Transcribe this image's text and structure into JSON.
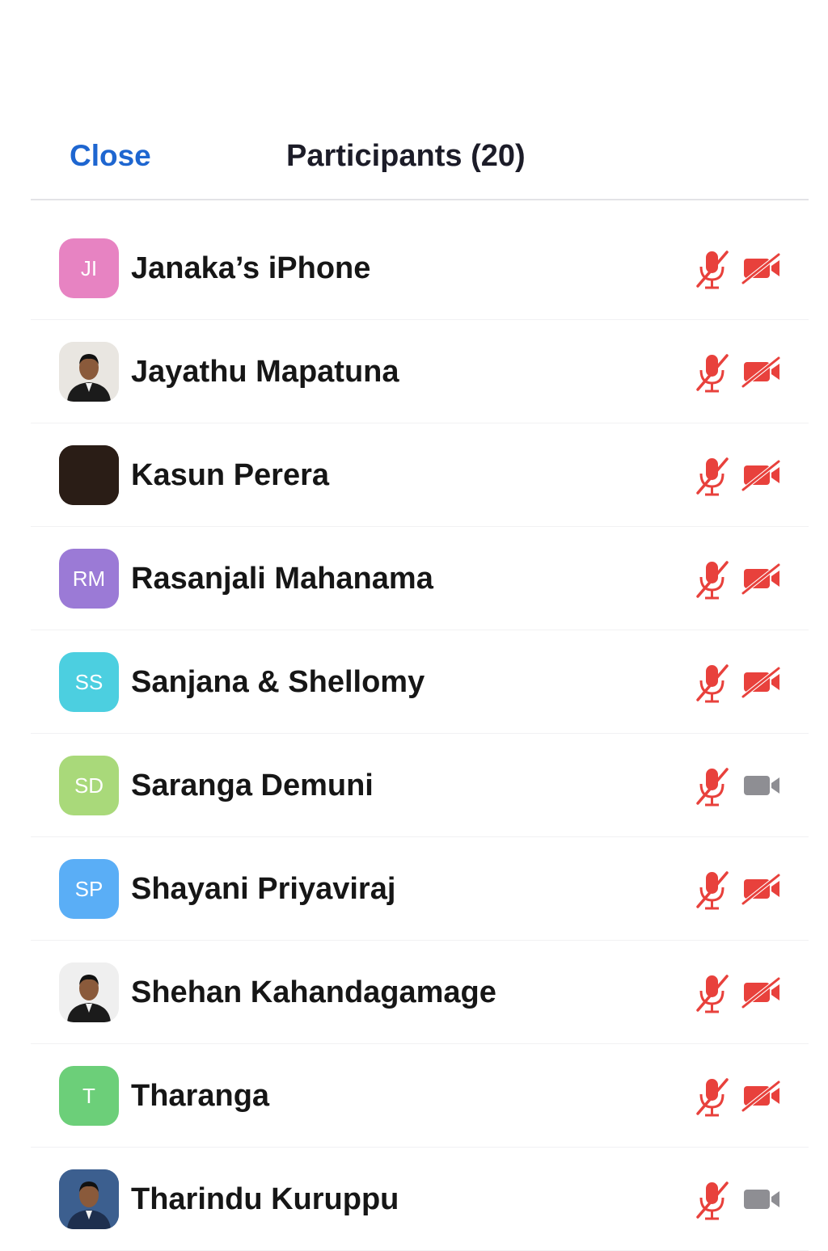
{
  "header": {
    "close_label": "Close",
    "title": "Participants (20)"
  },
  "colors": {
    "accent": "#1e66d0",
    "muted_red": "#e8413c",
    "video_on_gray": "#8e8e93"
  },
  "participants": [
    {
      "name": "Janaka’s iPhone",
      "initials": "JI",
      "avatar_type": "initials",
      "avatar_color": "#e783c2",
      "mic": "muted",
      "video": "off"
    },
    {
      "name": "Jayathu Mapatuna",
      "initials": "",
      "avatar_type": "photo",
      "avatar_color": "#e9e6e1",
      "mic": "muted",
      "video": "off"
    },
    {
      "name": "Kasun Perera",
      "initials": "",
      "avatar_type": "photo",
      "avatar_color": "#2a1d16",
      "mic": "muted",
      "video": "off"
    },
    {
      "name": "Rasanjali Mahanama",
      "initials": "RM",
      "avatar_type": "initials",
      "avatar_color": "#9b7ad6",
      "mic": "muted",
      "video": "off"
    },
    {
      "name": "Sanjana & Shellomy",
      "initials": "SS",
      "avatar_type": "initials",
      "avatar_color": "#4ccfe0",
      "mic": "muted",
      "video": "off"
    },
    {
      "name": "Saranga Demuni",
      "initials": "SD",
      "avatar_type": "initials",
      "avatar_color": "#a9d97a",
      "mic": "muted",
      "video": "on"
    },
    {
      "name": "Shayani Priyaviraj",
      "initials": "SP",
      "avatar_type": "initials",
      "avatar_color": "#5aaef6",
      "mic": "muted",
      "video": "off"
    },
    {
      "name": "Shehan Kahandagamage",
      "initials": "",
      "avatar_type": "photo",
      "avatar_color": "#efefef",
      "mic": "muted",
      "video": "off"
    },
    {
      "name": "Tharanga",
      "initials": "T",
      "avatar_type": "initials",
      "avatar_color": "#6ccf79",
      "mic": "muted",
      "video": "off"
    },
    {
      "name": "Tharindu Kuruppu",
      "initials": "",
      "avatar_type": "photo",
      "avatar_color": "#3c5f8f",
      "mic": "muted",
      "video": "on"
    }
  ]
}
